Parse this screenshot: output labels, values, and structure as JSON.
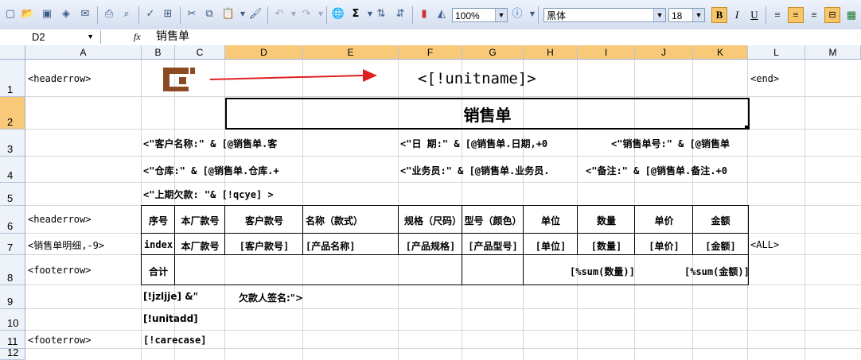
{
  "toolbar": {
    "zoom": "100%",
    "font_name": "黑体",
    "font_size": "18",
    "bold": "B",
    "italic": "I",
    "underline": "U",
    "sigma": "Σ"
  },
  "formula_bar": {
    "cell_ref": "D2",
    "fx": "fx",
    "content": "销售单"
  },
  "columns": [
    "A",
    "B",
    "C",
    "D",
    "E",
    "F",
    "G",
    "H",
    "I",
    "J",
    "K",
    "L",
    "M"
  ],
  "rows": [
    "1",
    "2",
    "3",
    "4",
    "5",
    "6",
    "7",
    "8",
    "9",
    "10",
    "11",
    "12"
  ],
  "cells": {
    "a1": "<headerrow>",
    "l1": "<end>",
    "title_field": "<[!unitname]>",
    "title": "销售单",
    "r3_b": "<\"客户名称:\" & [@销售单.客",
    "r3_f": "<\"日  期:\" & [@销售单.日期,+0",
    "r3_i": "<\"销售单号:\" & [@销售单",
    "r4_b": "<\"仓库:\" & [@销售单.仓库.+",
    "r4_f": "<\"业务员:\" & [@销售单.业务员.",
    "r4_h": "<\"备注:\" & [@销售单.备注.+0",
    "r5_b": "<\"上期欠款: \"& [!qcye] >",
    "a6": "<headerrow>",
    "h6": [
      "序号",
      "本厂款号",
      "客户款号",
      "名称（款式）",
      "规格（尺码）",
      "型号（颜色）",
      "单位",
      "数量",
      "单价",
      "金额"
    ],
    "a7": "<销售单明细,-9>",
    "r7": [
      "index",
      "本厂款号",
      "[客户款号]",
      "[产品名称]",
      "[产品规格]",
      "[产品型号]",
      "[单位]",
      "[数量]",
      "[单价]",
      "[金额]"
    ],
    "l7": "<ALL>",
    "a8": "<footerrow>",
    "b8": "合计",
    "r8_sum_qty": "[%sum(数量)]",
    "r8_sum_amt": "[%sum(金额)]",
    "r9": "[!jzljje] &\"",
    "r9_sig": "欠款人签名:\">",
    "r10": "[!unitadd]",
    "a11": "<footerrow>",
    "r11": "[!carecase]"
  }
}
